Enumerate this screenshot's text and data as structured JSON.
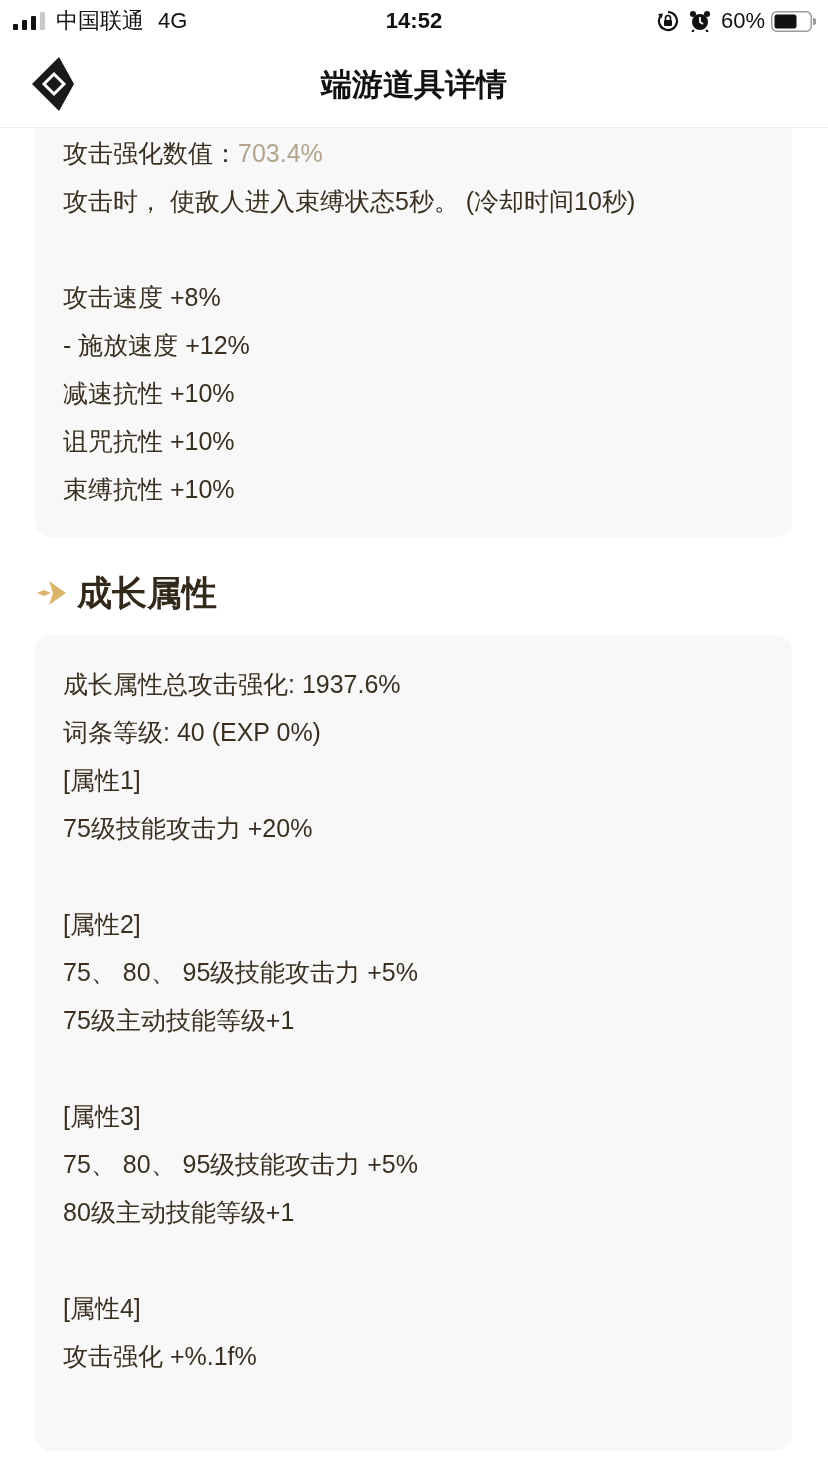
{
  "status_bar": {
    "carrier": "中国联通",
    "network": "4G",
    "time": "14:52",
    "battery": "60%"
  },
  "header": {
    "title": "端游道具详情"
  },
  "effect_card": {
    "paragraphs": [
      {
        "lines": [
          {
            "kind": "stat",
            "label": "攻击强化数值：",
            "value": "703.4%"
          },
          {
            "kind": "text",
            "text": "攻击时， 使敌人进入束缚状态5秒。 (冷却时间10秒)"
          }
        ]
      },
      {
        "lines": [
          {
            "kind": "text",
            "text": "攻击速度 +8%"
          },
          {
            "kind": "text",
            "text": "- 施放速度 +12%"
          },
          {
            "kind": "text",
            "text": "减速抗性 +10%"
          },
          {
            "kind": "text",
            "text": "诅咒抗性 +10%"
          },
          {
            "kind": "text",
            "text": "束缚抗性 +10%"
          }
        ]
      }
    ]
  },
  "growth_section": {
    "title": "成长属性",
    "paragraphs": [
      {
        "lines": [
          {
            "kind": "text",
            "text": "成长属性总攻击强化: 1937.6%"
          },
          {
            "kind": "text",
            "text": "词条等级: 40 (EXP 0%)"
          },
          {
            "kind": "text",
            "text": "[属性1]"
          },
          {
            "kind": "text",
            "text": "75级技能攻击力 +20%"
          }
        ]
      },
      {
        "lines": [
          {
            "kind": "text",
            "text": "[属性2]"
          },
          {
            "kind": "text",
            "text": "75、 80、 95级技能攻击力 +5%"
          },
          {
            "kind": "text",
            "text": "75级主动技能等级+1"
          }
        ]
      },
      {
        "lines": [
          {
            "kind": "text",
            "text": "[属性3]"
          },
          {
            "kind": "text",
            "text": "75、 80、 95级技能攻击力 +5%"
          },
          {
            "kind": "text",
            "text": "80级主动技能等级+1"
          }
        ]
      },
      {
        "lines": [
          {
            "kind": "text",
            "text": "[属性4]"
          },
          {
            "kind": "text",
            "text": "攻击强化 +%.1f%"
          }
        ]
      }
    ]
  }
}
